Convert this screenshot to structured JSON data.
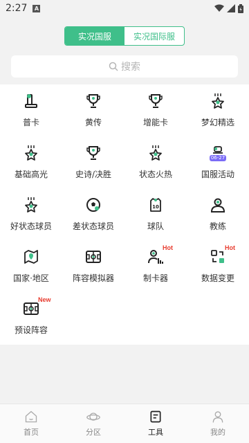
{
  "status": {
    "time": "2:27"
  },
  "segment": {
    "tabs": [
      "实况国服",
      "实况国际服"
    ],
    "active": 0
  },
  "search": {
    "placeholder": "搜索"
  },
  "colors": {
    "accent": "#3fbf8a",
    "hot": "#e83b2e",
    "tag": "#7b6cf6"
  },
  "tools": [
    {
      "label": "普卡",
      "icon": "card-icon"
    },
    {
      "label": "黄传",
      "icon": "trophy-icon"
    },
    {
      "label": "增能卡",
      "icon": "trophy-icon"
    },
    {
      "label": "梦幻精选",
      "icon": "star-icon"
    },
    {
      "label": "基础高光",
      "icon": "star-icon"
    },
    {
      "label": "史诗/决胜",
      "icon": "trophy-icon"
    },
    {
      "label": "状态火热",
      "icon": "star-icon"
    },
    {
      "label": "国服活动",
      "icon": "event-icon",
      "tag": "06-27"
    },
    {
      "label": "好状态球员",
      "icon": "star-icon"
    },
    {
      "label": "差状态球员",
      "icon": "ball-icon"
    },
    {
      "label": "球队",
      "icon": "jersey-icon"
    },
    {
      "label": "教练",
      "icon": "coach-icon"
    },
    {
      "label": "国家·地区",
      "icon": "map-icon"
    },
    {
      "label": "阵容模拟器",
      "icon": "pitch-icon"
    },
    {
      "label": "制卡器",
      "icon": "card-maker-icon",
      "badge": "Hot"
    },
    {
      "label": "数据变更",
      "icon": "data-change-icon",
      "badge": "Hot"
    },
    {
      "label": "预设阵容",
      "icon": "pitch-icon",
      "badge": "New"
    }
  ],
  "tabbar": [
    {
      "label": "首页",
      "icon": "home-icon"
    },
    {
      "label": "分区",
      "icon": "planet-icon"
    },
    {
      "label": "工具",
      "icon": "tools-icon",
      "active": true
    },
    {
      "label": "我的",
      "icon": "profile-icon"
    }
  ]
}
